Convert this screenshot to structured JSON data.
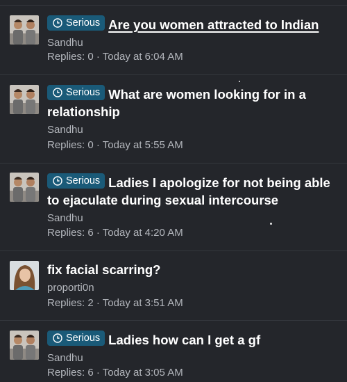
{
  "prefix_label": "Serious",
  "threads": [
    {
      "title": "Are you women attracted to Indian",
      "author": "Sandhu",
      "replies_label": "Replies:",
      "replies": "0",
      "time": "Today at 6:04 AM",
      "prefix": true
    },
    {
      "title": "What are women looking for in a relationship",
      "author": "Sandhu",
      "replies_label": "Replies:",
      "replies": "0",
      "time": "Today at 5:55 AM",
      "prefix": true
    },
    {
      "title": "Ladies I apologize for not being able to ejaculate during sexual intercourse",
      "author": "Sandhu",
      "replies_label": "Replies:",
      "replies": "6",
      "time": "Today at 4:20 AM",
      "prefix": true
    },
    {
      "title": "fix facial scarring?",
      "author": "proporti0n",
      "replies_label": "Replies:",
      "replies": "2",
      "time": "Today at 3:51 AM",
      "prefix": false
    },
    {
      "title": "Ladies how can I get a gf",
      "author": "Sandhu",
      "replies_label": "Replies:",
      "replies": "6",
      "time": "Today at 3:05 AM",
      "prefix": true
    }
  ],
  "meta_separator": "·",
  "colors": {
    "background": "#24262b",
    "prefix_bg": "#1a5a78",
    "muted_text": "#b4b7bd"
  }
}
